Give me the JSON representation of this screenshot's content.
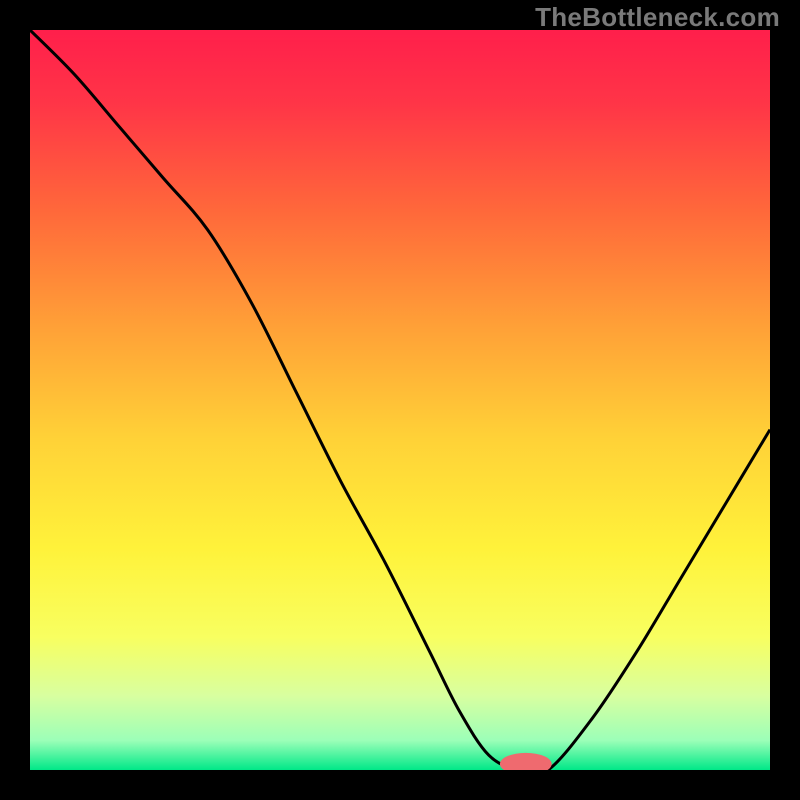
{
  "watermark": "TheBottleneck.com",
  "chart_data": {
    "type": "line",
    "title": "",
    "xlabel": "",
    "ylabel": "",
    "xlim": [
      0,
      100
    ],
    "ylim": [
      0,
      100
    ],
    "background_gradient": {
      "stops": [
        {
          "offset": 0.0,
          "color": "#ff1f4b"
        },
        {
          "offset": 0.1,
          "color": "#ff3547"
        },
        {
          "offset": 0.25,
          "color": "#ff6a3a"
        },
        {
          "offset": 0.4,
          "color": "#ffa037"
        },
        {
          "offset": 0.55,
          "color": "#ffd137"
        },
        {
          "offset": 0.7,
          "color": "#fff23a"
        },
        {
          "offset": 0.82,
          "color": "#f8ff60"
        },
        {
          "offset": 0.9,
          "color": "#d8ffa0"
        },
        {
          "offset": 0.96,
          "color": "#9cffb8"
        },
        {
          "offset": 1.0,
          "color": "#00e888"
        }
      ]
    },
    "series": [
      {
        "name": "bottleneck-curve",
        "color": "#000000",
        "x": [
          0,
          6,
          12,
          18,
          24,
          30,
          36,
          42,
          48,
          54,
          58,
          62,
          66,
          70,
          76,
          82,
          88,
          94,
          100
        ],
        "y": [
          100,
          94,
          87,
          80,
          73,
          63,
          51,
          39,
          28,
          16,
          8,
          2,
          0,
          0,
          7,
          16,
          26,
          36,
          46
        ]
      }
    ],
    "marker": {
      "name": "optimal-marker",
      "color": "#ef6a6f",
      "x": 67,
      "y": 0,
      "rx": 3.5,
      "ry": 1.5
    }
  }
}
